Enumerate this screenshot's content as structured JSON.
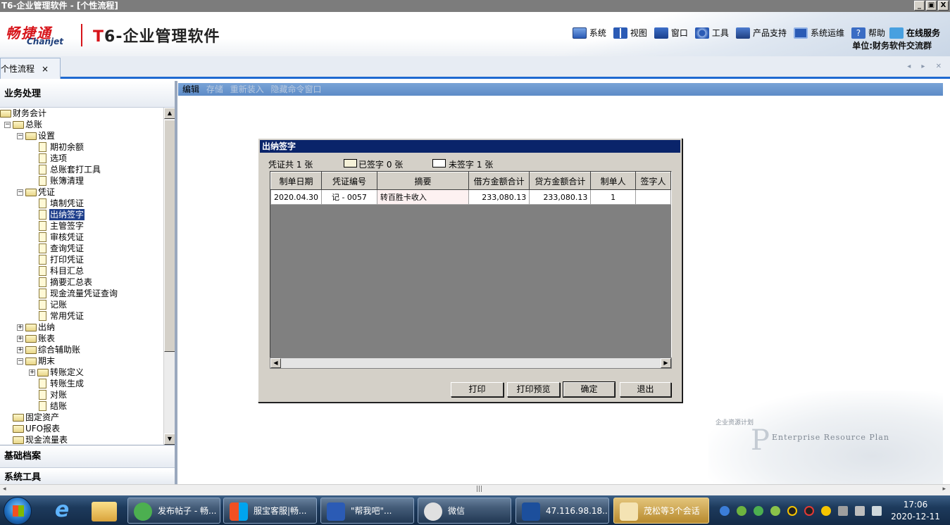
{
  "window": {
    "title": "T6-企业管理软件 - [个性流程]",
    "buttons": [
      "_",
      "▣",
      "X"
    ]
  },
  "header": {
    "brand_cn": "畅捷通",
    "brand_en": "Chanjet",
    "product_t": "T",
    "product_rest": "6-企业管理软件",
    "menu": [
      {
        "label": "系统",
        "icon": "system-icon"
      },
      {
        "label": "视图",
        "icon": "view-icon"
      },
      {
        "label": "窗口",
        "icon": "window-icon"
      },
      {
        "label": "工具",
        "icon": "tools-icon"
      },
      {
        "label": "产品支持",
        "icon": "product-support-icon"
      },
      {
        "label": "系统运维",
        "icon": "system-ops-icon"
      },
      {
        "label": "帮助",
        "icon": "help-icon"
      }
    ],
    "online_service": "在线服务",
    "unit": "单位:财务软件交流群"
  },
  "tabs": [
    {
      "label": "个性流程",
      "close": "×"
    }
  ],
  "tab_nav": "◂ ▸ ✕",
  "left_panel": {
    "business_title": "业务处理",
    "tree": [
      {
        "level": 0,
        "type": "folder",
        "exp": "−",
        "label": "财务会计"
      },
      {
        "level": 1,
        "type": "folder",
        "exp": "−",
        "label": "总账"
      },
      {
        "level": 2,
        "type": "folder",
        "exp": "−",
        "label": "设置"
      },
      {
        "level": 3,
        "type": "doc",
        "label": "期初余额"
      },
      {
        "level": 3,
        "type": "doc",
        "label": "选项"
      },
      {
        "level": 3,
        "type": "doc",
        "label": "总账套打工具"
      },
      {
        "level": 3,
        "type": "doc",
        "label": "账簿清理"
      },
      {
        "level": 2,
        "type": "folder",
        "exp": "−",
        "label": "凭证"
      },
      {
        "level": 3,
        "type": "doc",
        "label": "填制凭证"
      },
      {
        "level": 3,
        "type": "doc",
        "label": "出纳签字",
        "selected": true
      },
      {
        "level": 3,
        "type": "doc",
        "label": "主管签字"
      },
      {
        "level": 3,
        "type": "doc",
        "label": "审核凭证"
      },
      {
        "level": 3,
        "type": "doc",
        "label": "查询凭证"
      },
      {
        "level": 3,
        "type": "doc",
        "label": "打印凭证"
      },
      {
        "level": 3,
        "type": "doc",
        "label": "科目汇总"
      },
      {
        "level": 3,
        "type": "doc",
        "label": "摘要汇总表"
      },
      {
        "level": 3,
        "type": "doc",
        "label": "现金流量凭证查询"
      },
      {
        "level": 3,
        "type": "doc",
        "label": "记账"
      },
      {
        "level": 3,
        "type": "doc",
        "label": "常用凭证"
      },
      {
        "level": 2,
        "type": "folder",
        "exp": "+",
        "label": "出纳"
      },
      {
        "level": 2,
        "type": "folder",
        "exp": "+",
        "label": "账表"
      },
      {
        "level": 2,
        "type": "folder",
        "exp": "+",
        "label": "综合辅助账"
      },
      {
        "level": 2,
        "type": "folder",
        "exp": "−",
        "label": "期末"
      },
      {
        "level": 3,
        "type": "folder",
        "exp": "+",
        "label": "转账定义"
      },
      {
        "level": 3,
        "type": "doc",
        "label": "转账生成"
      },
      {
        "level": 3,
        "type": "doc",
        "label": "对账"
      },
      {
        "level": 3,
        "type": "doc",
        "label": "结账"
      },
      {
        "level": 1,
        "type": "folder",
        "label": "固定资产"
      },
      {
        "level": 1,
        "type": "folder",
        "label": "UFO报表"
      },
      {
        "level": 1,
        "type": "folder",
        "label": "现金流量表"
      }
    ],
    "basic_title": "基础档案",
    "systool_title": "系统工具"
  },
  "command_bar": [
    {
      "label": "编辑",
      "enabled": true
    },
    {
      "label": "存储",
      "enabled": false
    },
    {
      "label": "重新装入",
      "enabled": false
    },
    {
      "label": "隐藏命令窗口",
      "enabled": false
    }
  ],
  "watermark": {
    "cn": "企业资源计划",
    "en_p": "P",
    "en": "Enterprise Resource Plan"
  },
  "dialog": {
    "title": "出纳签字",
    "total": "凭证共 1 张",
    "signed": "已签字 0 张",
    "unsigned": "未签字 1 张",
    "signed_color": "#f5f1d8",
    "unsigned_color": "#ffffff",
    "columns": [
      "制单日期",
      "凭证编号",
      "摘要",
      "借方金额合计",
      "贷方金额合计",
      "制单人",
      "签字人"
    ],
    "rows": [
      [
        "2020.04.30",
        "记 - 0057",
        "转百胜卡收入",
        "233,080.13",
        "233,080.13",
        "1",
        ""
      ]
    ],
    "buttons": [
      "打印",
      "打印预览",
      "确定",
      "退出"
    ]
  },
  "taskbar": {
    "tasks": [
      {
        "label": "发布帖子 - 畅..."
      },
      {
        "label": "服宝客服|畅..."
      },
      {
        "label": "\"帮我吧\"..."
      },
      {
        "label": "微信"
      },
      {
        "label": "47.116.98.18..."
      },
      {
        "label": "茂松等3个会话"
      }
    ],
    "time": "17:06",
    "date": "2020-12-11"
  }
}
